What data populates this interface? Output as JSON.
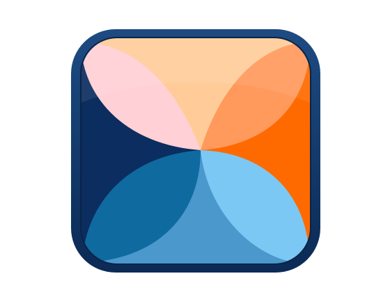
{
  "icon": {
    "name": "four-petal-app-icon",
    "colors": {
      "frame": "#0b2a55",
      "frame_highlight": "#1d4b82",
      "top_left_petal": "#ffd0d5",
      "top_wedge": "#ffcc99",
      "top_right_petal": "#ff9a5c",
      "right_wedge": "#ff6a00",
      "bottom_right_petal": "#7cc8f5",
      "bottom_wedge": "#4b98cc",
      "bottom_left_petal": "#0f6aa0",
      "left_wedge": "#0b2d5f"
    }
  }
}
